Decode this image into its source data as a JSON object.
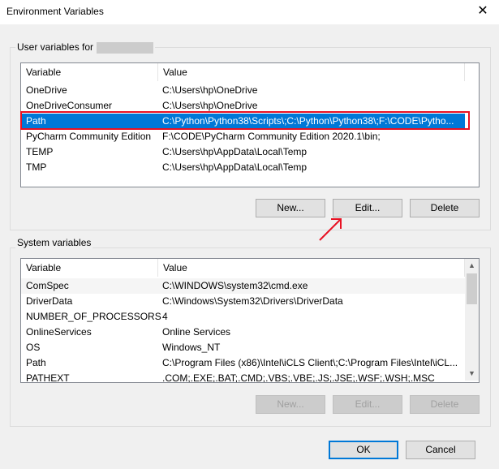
{
  "window": {
    "title": "Environment Variables",
    "close_glyph": "✕"
  },
  "user_group": {
    "label": "User variables for",
    "columns": [
      "Variable",
      "Value"
    ],
    "rows": [
      {
        "variable": "OneDrive",
        "value": "C:\\Users\\hp\\OneDrive"
      },
      {
        "variable": "OneDriveConsumer",
        "value": "C:\\Users\\hp\\OneDrive"
      },
      {
        "variable": "Path",
        "value": "C:\\Python\\Python38\\Scripts\\;C:\\Python\\Python38\\;F:\\CODE\\Pytho..."
      },
      {
        "variable": "PyCharm Community Edition",
        "value": "F:\\CODE\\PyCharm Community Edition 2020.1\\bin;"
      },
      {
        "variable": "TEMP",
        "value": "C:\\Users\\hp\\AppData\\Local\\Temp"
      },
      {
        "variable": "TMP",
        "value": "C:\\Users\\hp\\AppData\\Local\\Temp"
      }
    ],
    "buttons": {
      "new": "New...",
      "edit": "Edit...",
      "delete": "Delete"
    }
  },
  "system_group": {
    "label": "System variables",
    "columns": [
      "Variable",
      "Value"
    ],
    "rows": [
      {
        "variable": "ComSpec",
        "value": "C:\\WINDOWS\\system32\\cmd.exe"
      },
      {
        "variable": "DriverData",
        "value": "C:\\Windows\\System32\\Drivers\\DriverData"
      },
      {
        "variable": "NUMBER_OF_PROCESSORS",
        "value": "4"
      },
      {
        "variable": "OnlineServices",
        "value": "Online Services"
      },
      {
        "variable": "OS",
        "value": "Windows_NT"
      },
      {
        "variable": "Path",
        "value": "C:\\Program Files (x86)\\Intel\\iCLS Client\\;C:\\Program Files\\Intel\\iCL..."
      },
      {
        "variable": "PATHEXT",
        "value": ".COM;.EXE;.BAT;.CMD;.VBS;.VBE;.JS;.JSE;.WSF;.WSH;.MSC"
      }
    ],
    "buttons": {
      "new": "New...",
      "edit": "Edit...",
      "delete": "Delete"
    }
  },
  "footer": {
    "ok": "OK",
    "cancel": "Cancel"
  },
  "colors": {
    "selection": "#0078d7",
    "annotation": "#e81123"
  }
}
